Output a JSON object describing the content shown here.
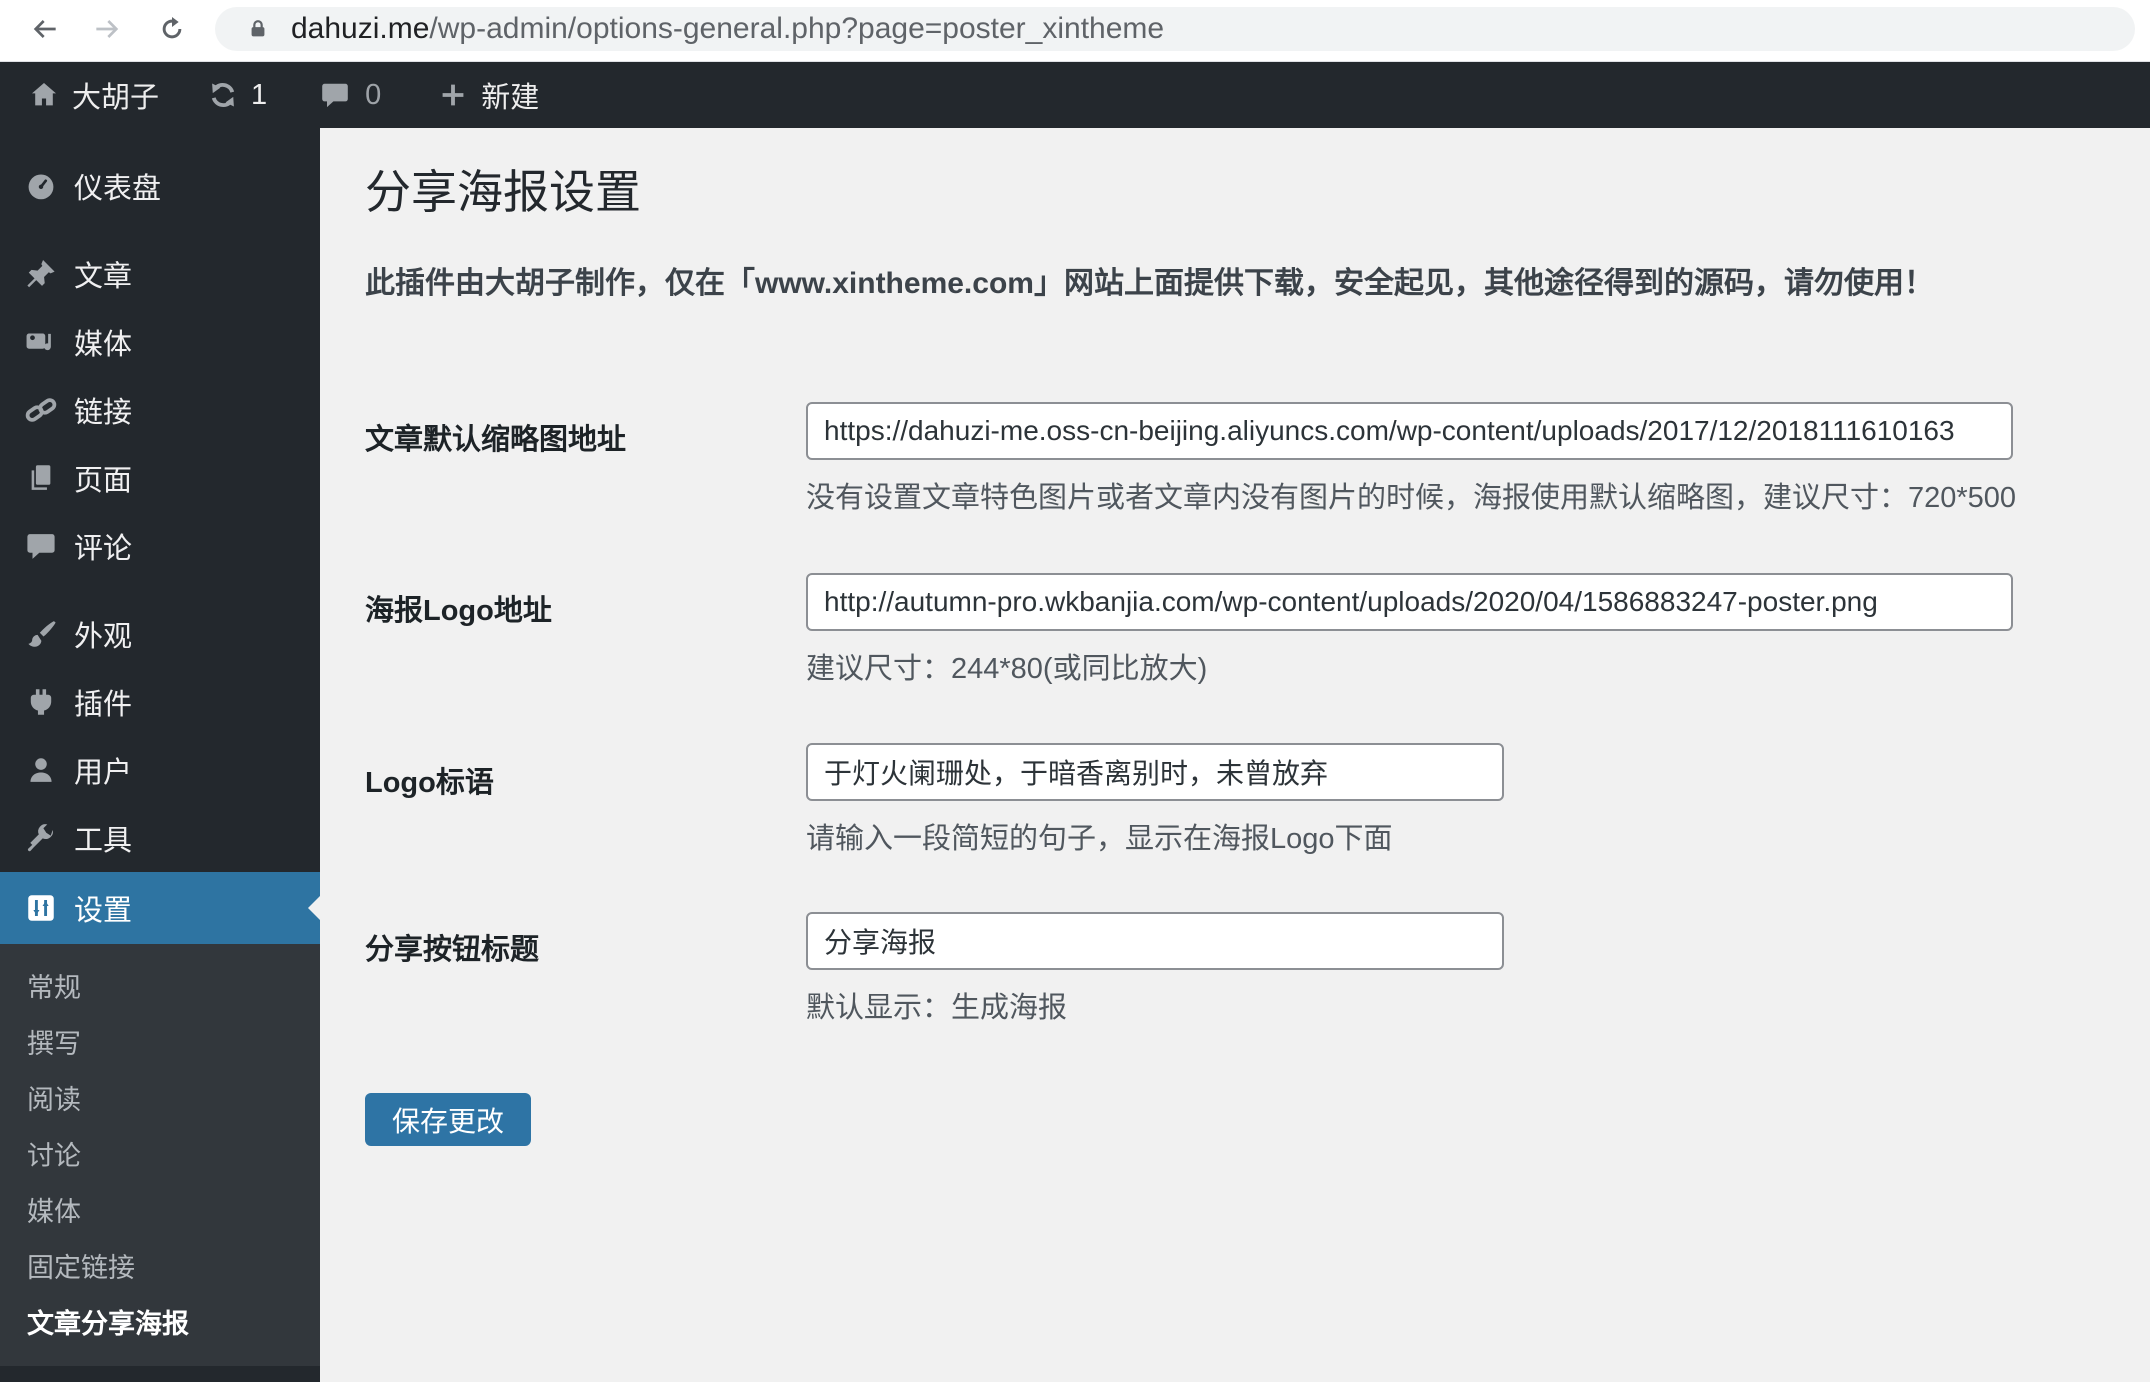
{
  "browser": {
    "url_domain": "dahuzi.me",
    "url_path": "/wp-admin/options-general.php?page=poster_xintheme"
  },
  "admin_bar": {
    "site_name": "大胡子",
    "update_count": "1",
    "comment_count": "0",
    "new_label": "新建"
  },
  "sidebar": {
    "items": [
      {
        "label": "仪表盘"
      },
      {
        "label": "文章"
      },
      {
        "label": "媒体"
      },
      {
        "label": "链接"
      },
      {
        "label": "页面"
      },
      {
        "label": "评论"
      },
      {
        "label": "外观"
      },
      {
        "label": "插件"
      },
      {
        "label": "用户"
      },
      {
        "label": "工具"
      },
      {
        "label": "设置"
      }
    ],
    "submenu": [
      {
        "label": "常规"
      },
      {
        "label": "撰写"
      },
      {
        "label": "阅读"
      },
      {
        "label": "讨论"
      },
      {
        "label": "媒体"
      },
      {
        "label": "固定链接"
      },
      {
        "label": "文章分享海报"
      }
    ]
  },
  "content": {
    "title": "分享海报设置",
    "notice": "此插件由大胡子制作，仅在「www.xintheme.com」网站上面提供下载，安全起见，其他途径得到的源码，请勿使用！",
    "fields": [
      {
        "label": "文章默认缩略图地址",
        "value": "https://dahuzi-me.oss-cn-beijing.aliyuncs.com/wp-content/uploads/2017/12/2018111610163",
        "helper": "没有设置文章特色图片或者文章内没有图片的时候，海报使用默认缩略图，建议尺寸：720*500"
      },
      {
        "label": "海报Logo地址",
        "value": "http://autumn-pro.wkbanjia.com/wp-content/uploads/2020/04/1586883247-poster.png",
        "helper": "建议尺寸：244*80(或同比放大)"
      },
      {
        "label": "Logo标语",
        "value": "于灯火阑珊处，于暗香离别时，未曾放弃",
        "helper": "请输入一段简短的句子，显示在海报Logo下面"
      },
      {
        "label": "分享按钮标题",
        "value": "分享海报",
        "helper": "默认显示：生成海报"
      }
    ],
    "save_label": "保存更改"
  },
  "colors": {
    "accent_blue": "#2e74a2",
    "button_blue": "#2e74a5",
    "sidebar_bg": "#23282d",
    "submenu_bg": "#32373c",
    "content_bg": "#f1f1f1"
  }
}
